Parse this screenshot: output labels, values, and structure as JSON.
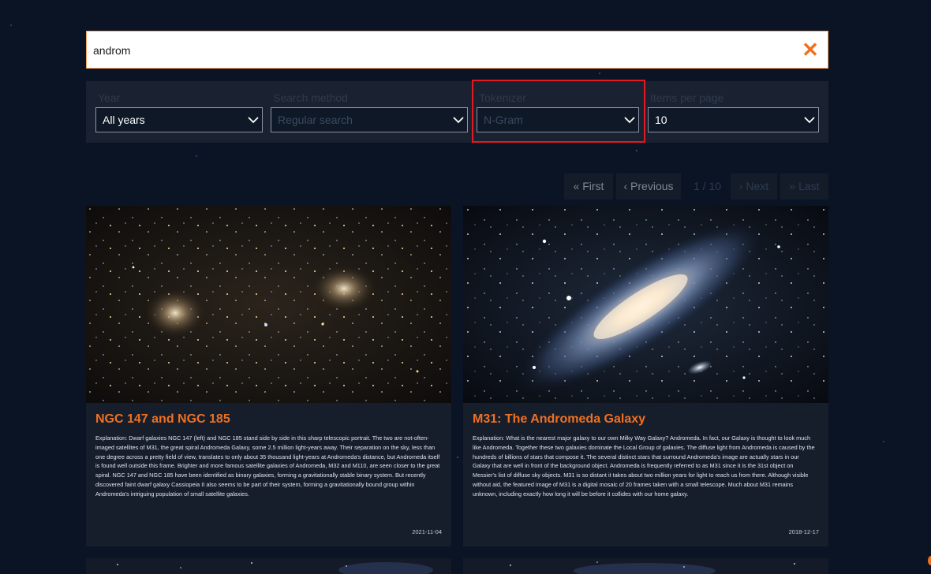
{
  "search": {
    "value": "androm",
    "clear_icon": "close-icon"
  },
  "filters": [
    {
      "label": "Year",
      "value": "All years",
      "disabled": false
    },
    {
      "label": "Search method",
      "value": "Regular search",
      "disabled": true
    },
    {
      "label": "Tokenizer",
      "value": "N-Gram",
      "disabled": true
    },
    {
      "label": "Items per page",
      "value": "10",
      "disabled": false
    }
  ],
  "pagination": {
    "first": "First",
    "previous": "Previous",
    "page_info": "1 / 10",
    "next": "Next",
    "last": "Last"
  },
  "cards": [
    {
      "title": "NGC 147 and NGC 185",
      "text": "Explanation: Dwarf galaxies NGC 147 (left) and NGC 185 stand side by side in this sharp telescopic portrait. The two are not-often-imaged satellites of M31, the great spiral Andromeda Galaxy, some 2.5 million light-years away. Their separation on the sky, less than one degree across a pretty field of view, translates to only about 35 thousand light-years at Andromeda's distance, but Andromeda itself is found well outside this frame. Brighter and more famous satellite galaxies of Andromeda, M32 and M110, are seen closer to the great spiral. NGC 147 and NGC 185 have been identified as binary galaxies, forming a gravitationally stable binary system. But recently discovered faint dwarf galaxy Cassiopeia II also seems to be part of their system, forming a gravitationally bound group within Andromeda's intriguing population of small satellite galaxies.",
      "date": "2021-11-04"
    },
    {
      "title": "M31: The Andromeda Galaxy",
      "text": "Explanation: What is the nearest major galaxy to our own Milky Way Galaxy? Andromeda. In fact, our Galaxy is thought to look much like Andromeda. Together these two galaxies dominate the Local Group of galaxies. The diffuse light from Andromeda is caused by the hundreds of billions of stars that compose it. The several distinct stars that surround Andromeda's image are actually stars in our Galaxy that are well in front of the background object. Andromeda is frequently referred to as M31 since it is the 31st object on Messier's list of diffuse sky objects. M31 is so distant it takes about two million years for light to reach us from there. Although visible without aid, the featured image of M31 is a digital mosaic of 20 frames taken with a small telescope. Much about M31 remains unknown, including exactly how long it will be before it collides with our home galaxy.",
      "date": "2018-12-17"
    }
  ],
  "colors": {
    "accent": "#f07020",
    "background": "#0b1424",
    "card": "#161e2c",
    "highlight": "#e21b23"
  }
}
